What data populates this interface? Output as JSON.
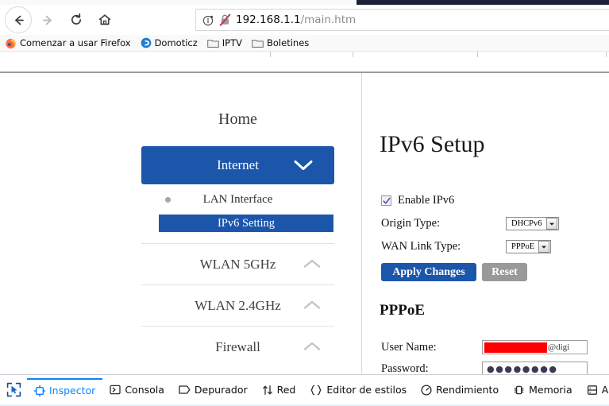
{
  "browser": {
    "nav": {
      "back": "back-arrow",
      "forward": "forward-arrow",
      "reload": "reload",
      "home": "home"
    },
    "url": {
      "host": "192.168.1.1",
      "path": "/main.htm",
      "info_icon": "info-icon",
      "insecure_icon": "broken-lock-icon"
    },
    "bookmarks": [
      {
        "label": "Comenzar a usar Firefox",
        "icon": "firefox-icon"
      },
      {
        "label": "Domoticz",
        "icon": "domoticz-icon"
      },
      {
        "label": "IPTV",
        "icon": "folder-icon"
      },
      {
        "label": "Boletines",
        "icon": "folder-icon"
      }
    ]
  },
  "sidebar": {
    "home_label": "Home",
    "active_section": {
      "label": "Internet",
      "chevron": "chevron-down-icon"
    },
    "sub_items": [
      {
        "label": "LAN Interface",
        "active": false
      },
      {
        "label": "IPv6 Setting",
        "active": true
      }
    ],
    "sections": [
      {
        "label": "WLAN 5GHz",
        "chevron": "chevron-up-icon"
      },
      {
        "label": "WLAN 2.4GHz",
        "chevron": "chevron-up-icon"
      },
      {
        "label": "Firewall",
        "chevron": "chevron-up-icon"
      }
    ]
  },
  "content": {
    "title": "IPv6 Setup",
    "enable_ipv6": {
      "label": "Enable IPv6",
      "checked": true
    },
    "origin_type": {
      "label": "Origin Type:",
      "value": "DHCPv6"
    },
    "wan_link_type": {
      "label": "WAN Link Type:",
      "value": "PPPoE"
    },
    "apply_button": "Apply Changes",
    "reset_button": "Reset",
    "pppoe_heading": "PPPoE",
    "user_name": {
      "label": "User Name:",
      "value": "",
      "suffix": "@digi"
    },
    "password": {
      "label": "Password:",
      "value": "●●●●●●●●"
    }
  },
  "devtools": {
    "picker_icon": "element-picker-icon",
    "tabs": [
      {
        "label": "Inspector",
        "icon": "inspector-icon",
        "active": true
      },
      {
        "label": "Consola",
        "icon": "console-icon",
        "active": false
      },
      {
        "label": "Depurador",
        "icon": "debugger-icon",
        "active": false
      },
      {
        "label": "Red",
        "icon": "network-icon",
        "active": false
      },
      {
        "label": "Editor de estilos",
        "icon": "style-editor-icon",
        "active": false
      },
      {
        "label": "Rendimiento",
        "icon": "performance-icon",
        "active": false
      },
      {
        "label": "Memoria",
        "icon": "memory-icon",
        "active": false
      },
      {
        "label": "Almacenamiento",
        "icon": "storage-icon",
        "active": false
      }
    ]
  },
  "colors": {
    "accent_blue": "#1c56ab",
    "devtools_blue": "#0a84ff",
    "redaction_red": "#ff0000",
    "reset_gray": "#999999"
  }
}
